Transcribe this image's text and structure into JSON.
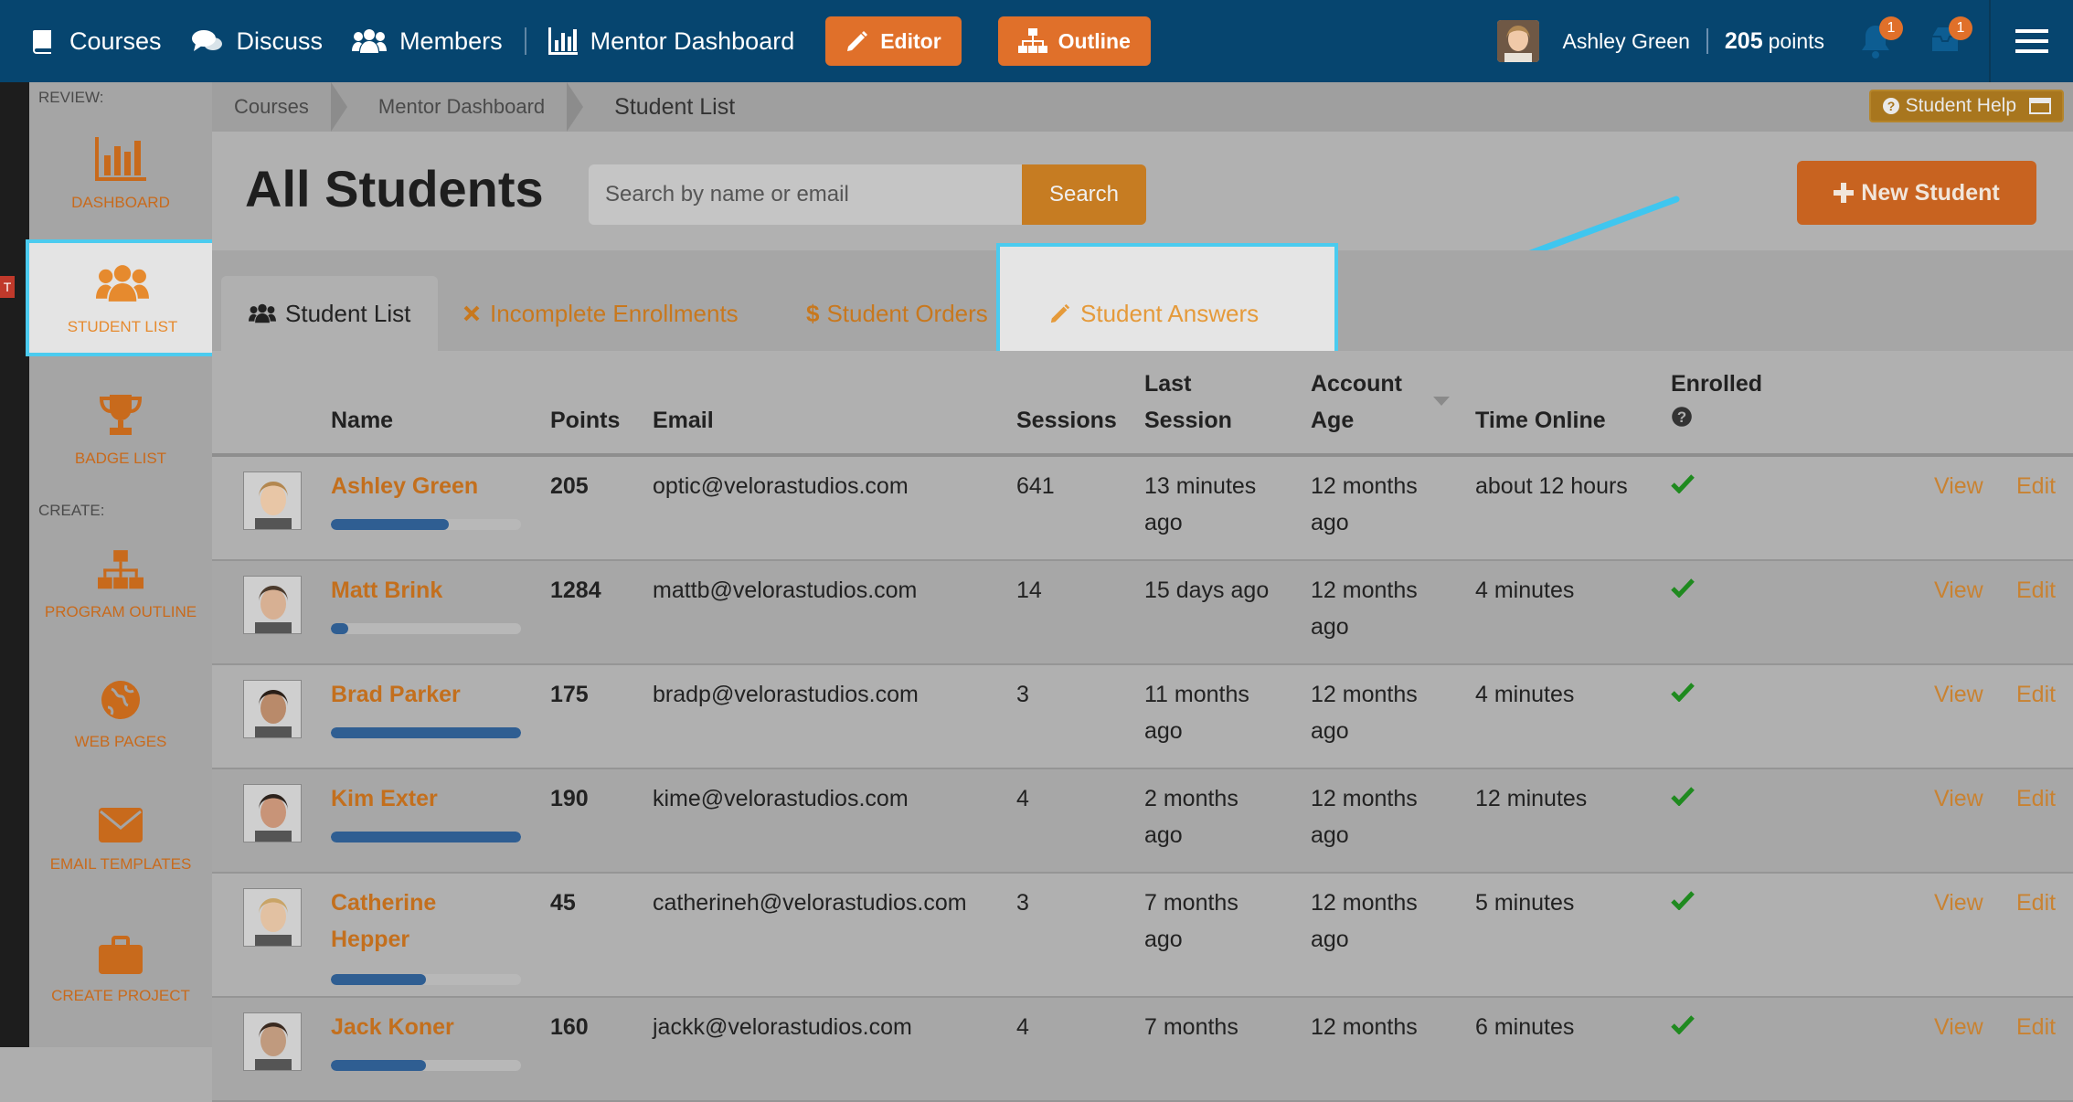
{
  "nav": {
    "items": [
      {
        "label": "Courses",
        "icon": "book-icon"
      },
      {
        "label": "Discuss",
        "icon": "comments-icon"
      },
      {
        "label": "Members",
        "icon": "users-icon"
      },
      {
        "label": "Mentor Dashboard",
        "icon": "bar-chart-icon"
      }
    ],
    "editor_label": "Editor",
    "outline_label": "Outline",
    "user_name": "Ashley Green",
    "points_value": "205",
    "points_label": "points",
    "notif_count": "1",
    "inbox_count": "1"
  },
  "sidebar": {
    "review_label": "REVIEW:",
    "create_label": "CREATE:",
    "items": [
      {
        "label": "DASHBOARD",
        "icon": "bar-chart-icon"
      },
      {
        "label": "STUDENT LIST",
        "icon": "users-icon"
      },
      {
        "label": "BADGE LIST",
        "icon": "trophy-icon"
      },
      {
        "label": "PROGRAM OUTLINE",
        "icon": "sitemap-icon"
      },
      {
        "label": "WEB PAGES",
        "icon": "globe-icon"
      },
      {
        "label": "EMAIL TEMPLATES",
        "icon": "envelope-icon"
      },
      {
        "label": "CREATE PROJECT",
        "icon": "briefcase-icon"
      }
    ],
    "red_tab": "T"
  },
  "breadcrumb": {
    "items": [
      "Courses",
      "Mentor Dashboard"
    ],
    "current": "Student List",
    "help_label": "Student Help"
  },
  "header": {
    "title": "All Students",
    "search_placeholder": "Search by name or email",
    "search_button": "Search",
    "new_student_label": "New Student"
  },
  "tabs": [
    {
      "label": "Student List",
      "icon": "users-icon"
    },
    {
      "label": "Incomplete Enrollments",
      "icon": "times-icon"
    },
    {
      "label": "Student Orders",
      "icon": "dollar-icon"
    },
    {
      "label": "Student Answers",
      "icon": "pencil-icon"
    }
  ],
  "table": {
    "columns": {
      "name": "Name",
      "points": "Points",
      "email": "Email",
      "sessions": "Sessions",
      "last_session_1": "Last",
      "last_session_2": "Session",
      "account_age_1": "Account",
      "account_age_2": "Age",
      "time_online": "Time Online",
      "enrolled": "Enrolled"
    },
    "view_label": "View",
    "edit_label": "Edit",
    "rows": [
      {
        "name": "Ashley Green",
        "points": "205",
        "email": "optic@velorastudios.com",
        "sessions": "641",
        "last1": "13 minutes",
        "last2": "ago",
        "age1": "12 months",
        "age2": "ago",
        "online": "about 12 hours",
        "progress": 0.62
      },
      {
        "name": "Matt Brink",
        "points": "1284",
        "email": "mattb@velorastudios.com",
        "sessions": "14",
        "last1": "15 days ago",
        "last2": "",
        "age1": "12 months",
        "age2": "ago",
        "online": "4 minutes",
        "progress": 0.09
      },
      {
        "name": "Brad Parker",
        "points": "175",
        "email": "bradp@velorastudios.com",
        "sessions": "3",
        "last1": "11 months",
        "last2": "ago",
        "age1": "12 months",
        "age2": "ago",
        "online": "4 minutes",
        "progress": 1.0
      },
      {
        "name": "Kim Exter",
        "points": "190",
        "email": "kime@velorastudios.com",
        "sessions": "4",
        "last1": "2 months",
        "last2": "ago",
        "age1": "12 months",
        "age2": "ago",
        "online": "12 minutes",
        "progress": 1.0
      },
      {
        "name1": "Catherine",
        "name2": "Hepper",
        "points": "45",
        "email": "catherineh@velorastudios.com",
        "sessions": "3",
        "last1": "7 months",
        "last2": "ago",
        "age1": "12 months",
        "age2": "ago",
        "online": "5 minutes",
        "progress": 0.5
      },
      {
        "name": "Jack Koner",
        "points": "160",
        "email": "jackk@velorastudios.com",
        "sessions": "4",
        "last1": "7 months",
        "last2": "",
        "age1": "12 months",
        "age2": "",
        "online": "6 minutes",
        "progress": 0.5
      }
    ]
  },
  "colors": {
    "accent": "#e0702a",
    "topbar": "#06456f",
    "highlight": "#4bcbef",
    "link": "#c36f1d"
  }
}
